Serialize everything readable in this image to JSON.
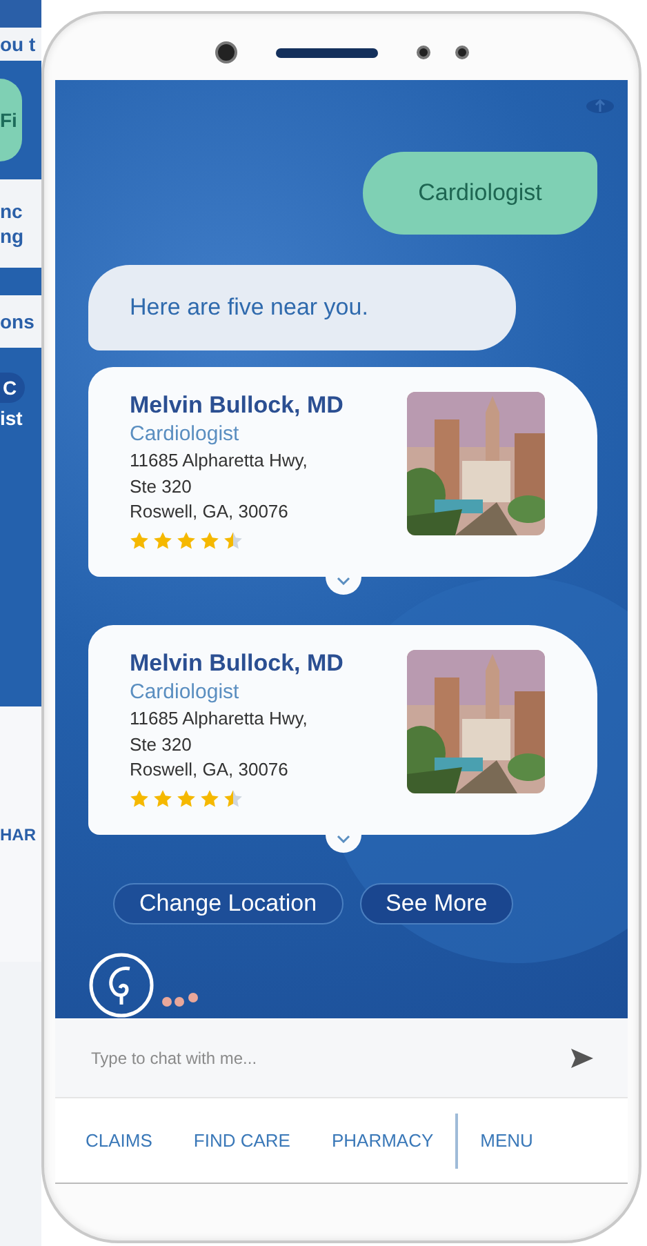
{
  "background_screen": {
    "fragments": [
      "ou t",
      "Fi",
      "nc",
      "ng",
      "ons",
      "C",
      "ist",
      "HAR"
    ]
  },
  "chat": {
    "messages": [
      {
        "kind": "user",
        "text": "Cardiologist"
      },
      {
        "kind": "bot",
        "text": "Here are five near you."
      }
    ],
    "doctors": [
      {
        "name": "Melvin Bullock, MD",
        "specialty": "Cardiologist",
        "address": [
          "11685 Alpharetta Hwy,",
          "Ste 320",
          "Roswell, GA, 30076"
        ],
        "stars": 4.5,
        "image": {
          "kind": "picture"
        }
      },
      {
        "name": "Melvin Bullock, MD",
        "specialty": "Cardiologist",
        "address": [
          "11685 Alpharetta Hwy,",
          "Ste 320",
          "Roswell, GA, 30076"
        ],
        "stars": 4.5,
        "image": {
          "kind": "picture"
        }
      }
    ],
    "actions": [
      {
        "label": "Change Location",
        "kind": "outline"
      },
      {
        "label": "See More",
        "kind": "filled"
      }
    ]
  },
  "composer": {
    "placeholder": "Type to chat with me..."
  },
  "nav": {
    "items": [
      {
        "label": "CLAIMS",
        "kind": "link"
      },
      {
        "label": "FIND CARE",
        "kind": "link"
      },
      {
        "label": "PHARMACY",
        "kind": "link"
      },
      {
        "label": "MENU",
        "kind": "menu"
      }
    ]
  }
}
